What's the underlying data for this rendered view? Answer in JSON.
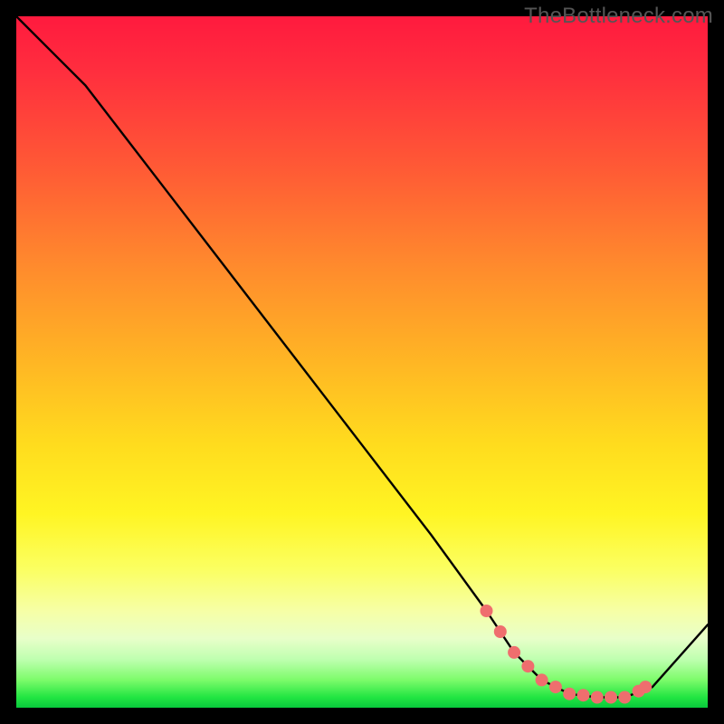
{
  "watermark": "TheBottleneck.com",
  "chart_data": {
    "type": "line",
    "title": "",
    "xlabel": "",
    "ylabel": "",
    "xlim": [
      0,
      100
    ],
    "ylim": [
      0,
      100
    ],
    "series": [
      {
        "name": "curve",
        "x": [
          0,
          6,
          10,
          20,
          30,
          40,
          50,
          60,
          68,
          72,
          76,
          80,
          84,
          88,
          92,
          100
        ],
        "y": [
          100,
          94,
          90,
          77,
          64,
          51,
          38,
          25,
          14,
          8,
          4,
          2,
          1.5,
          1.5,
          3,
          12
        ]
      }
    ],
    "highlight_points": {
      "name": "flat-region-markers",
      "x": [
        68,
        70,
        72,
        74,
        76,
        78,
        80,
        82,
        84,
        86,
        88,
        90,
        91
      ],
      "y": [
        14,
        11,
        8,
        6,
        4,
        3,
        2,
        1.8,
        1.5,
        1.5,
        1.5,
        2.4,
        3
      ]
    },
    "colors": {
      "curve": "#000000",
      "markers": "#ef6e6e"
    }
  }
}
